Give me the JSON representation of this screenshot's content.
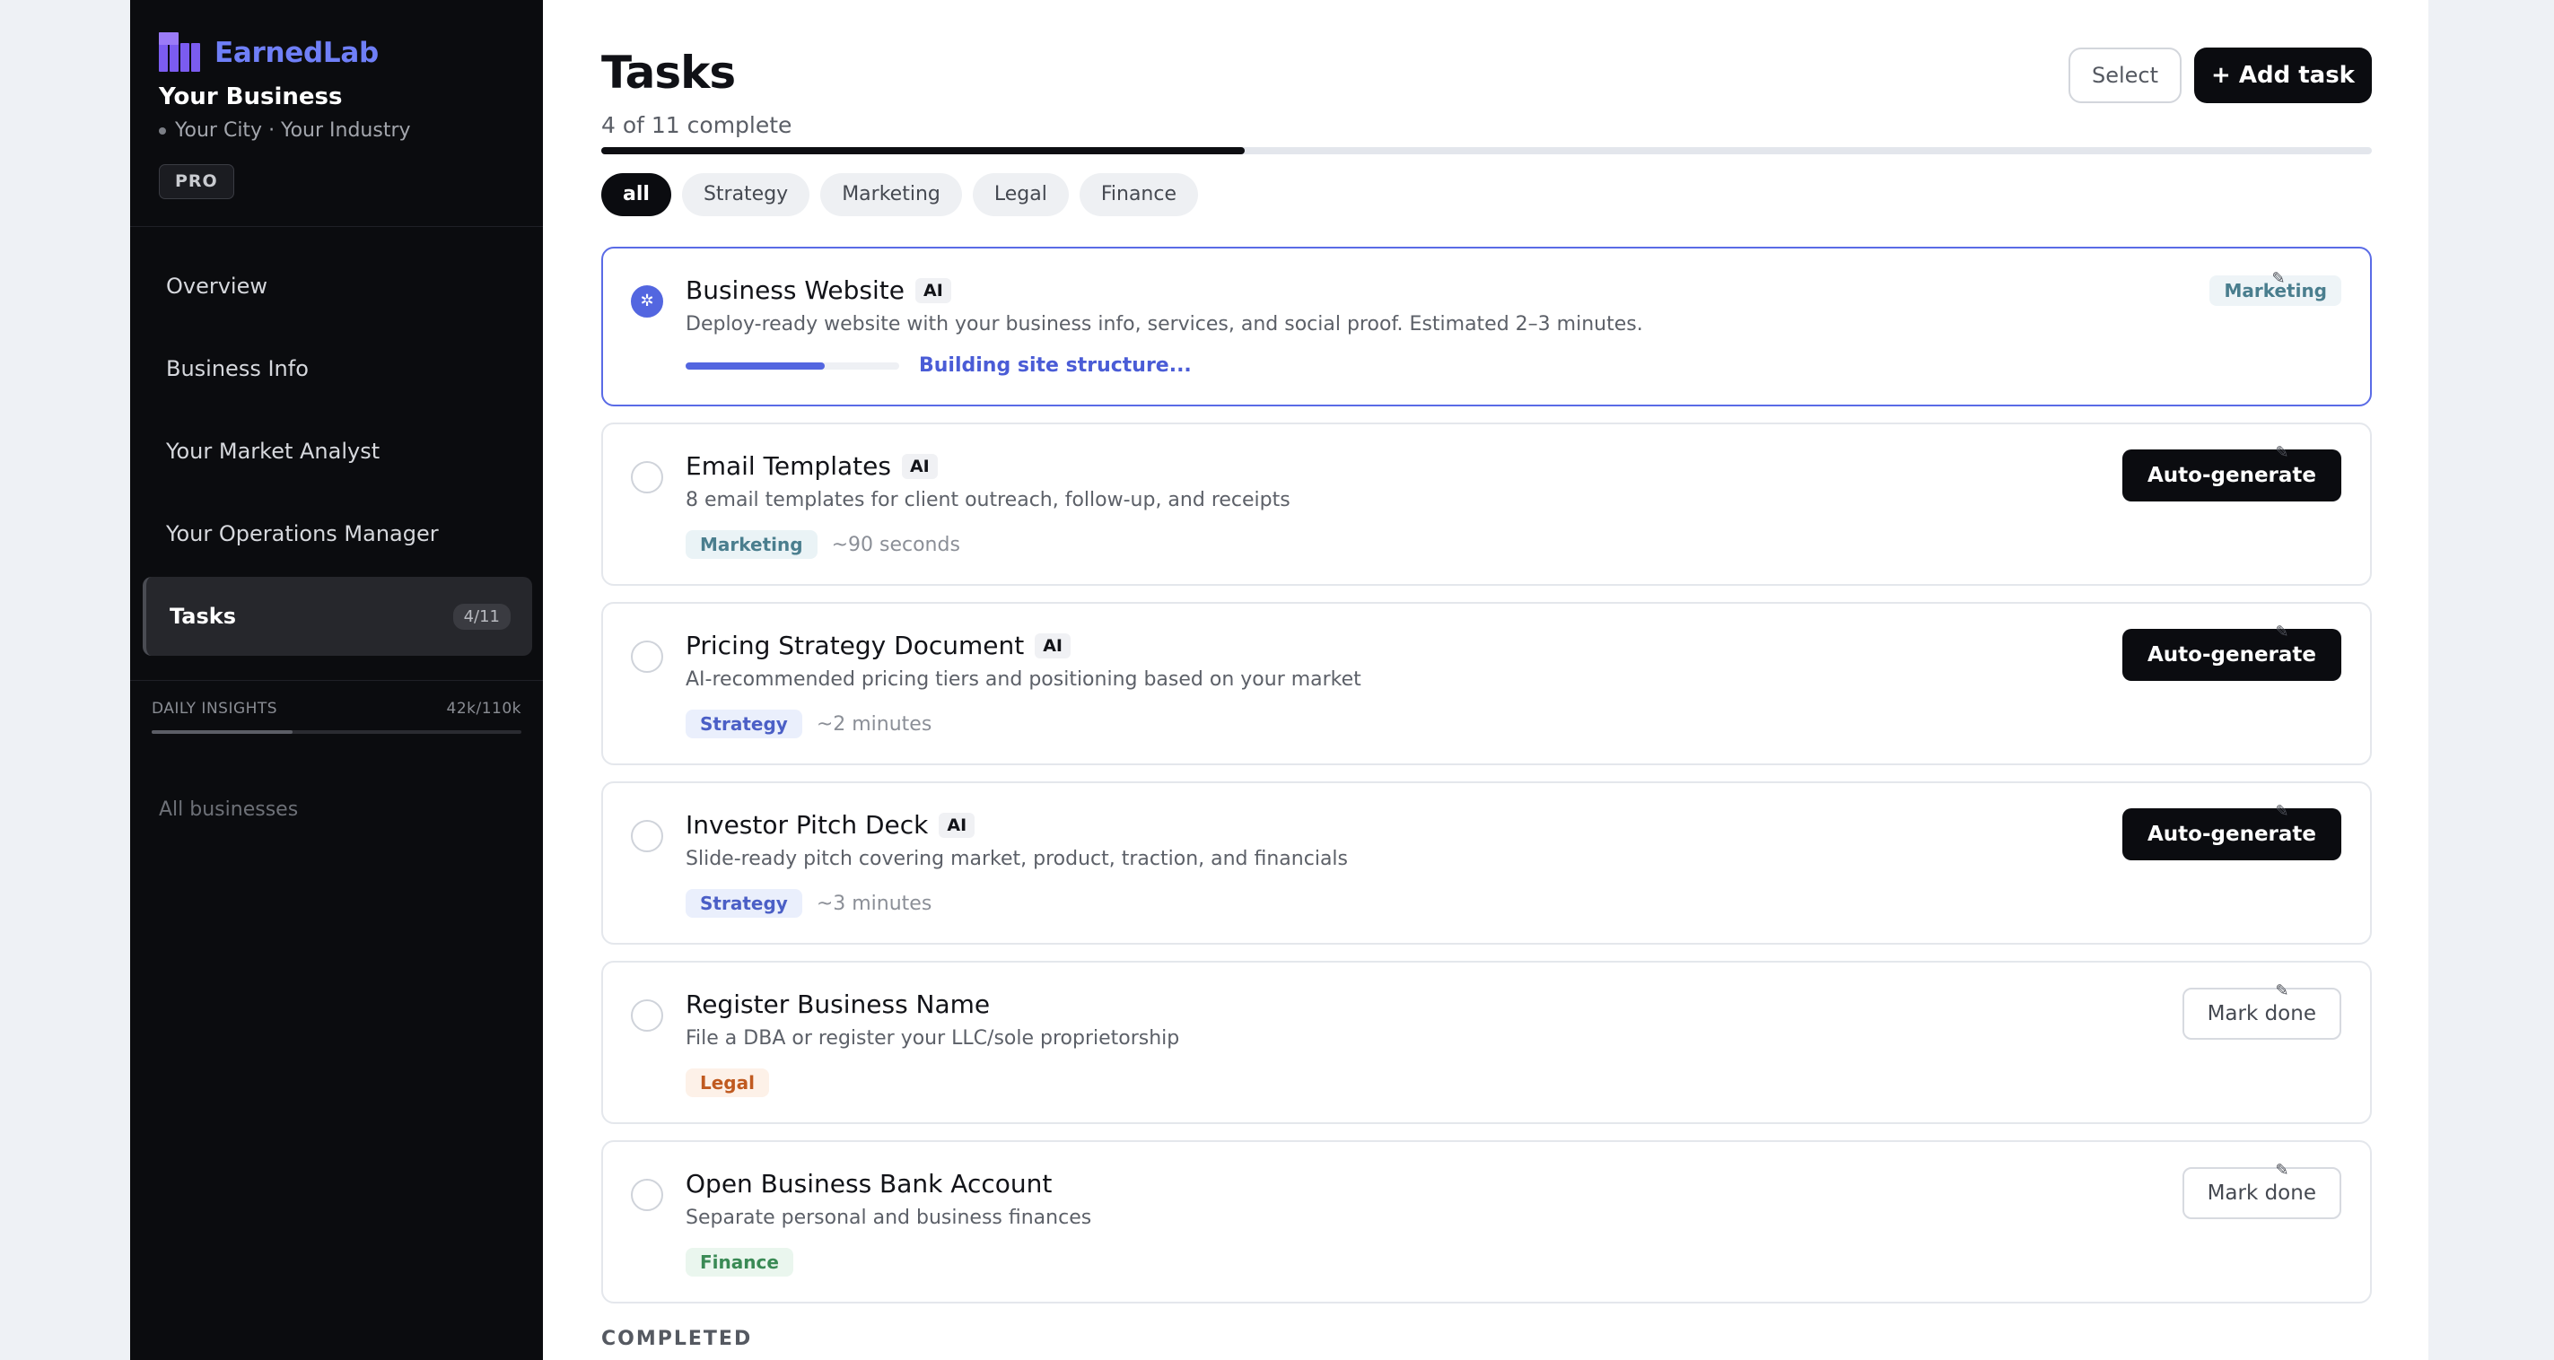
{
  "sidebar": {
    "brand": "EarnedLab",
    "business_name": "Your Business",
    "business_meta": "Your City · Your Industry",
    "plan_badge": "PRO",
    "nav": [
      {
        "label": "Overview"
      },
      {
        "label": "Business Info"
      },
      {
        "label": "Your Market Analyst"
      },
      {
        "label": "Your Operations Manager"
      },
      {
        "label": "Tasks",
        "count": "4/11",
        "active": true
      }
    ],
    "insights_label": "DAILY INSIGHTS",
    "insights_value": "42k/110k",
    "insights_fraction": 0.38,
    "all_businesses": "All businesses",
    "colors": {
      "brand_accent": "#6f7ff7",
      "logo": "#7b5cf0"
    }
  },
  "main": {
    "title": "Tasks",
    "progress_text": "4 of 11 complete",
    "progress_fraction": 0.3636,
    "select_label": "Select",
    "add_task_label": "+ Add task",
    "filters": [
      "all",
      "Strategy",
      "Marketing",
      "Legal",
      "Finance"
    ],
    "active_filter": "all",
    "tasks": [
      {
        "title": "Business Website",
        "ai": "AI",
        "description": "Deploy-ready website with your business info, services, and social proof. Estimated 2–3 minutes.",
        "status_text": "Building site structure...",
        "build_progress": 0.65,
        "category": "Marketing"
      },
      {
        "title": "Email Templates",
        "ai": "AI",
        "description": "8 email templates for client outreach, follow-up, and receipts",
        "category": "Marketing",
        "duration": "~90 seconds",
        "action": "Auto-generate"
      },
      {
        "title": "Pricing Strategy Document",
        "ai": "AI",
        "description": "AI-recommended pricing tiers and positioning based on your market",
        "category": "Strategy",
        "duration": "~2 minutes",
        "action": "Auto-generate"
      },
      {
        "title": "Investor Pitch Deck",
        "ai": "AI",
        "description": "Slide-ready pitch covering market, product, traction, and financials",
        "category": "Strategy",
        "duration": "~3 minutes",
        "action": "Auto-generate"
      },
      {
        "title": "Register Business Name",
        "description": "File a DBA or register your LLC/sole proprietorship",
        "category": "Legal",
        "action": "Mark done"
      },
      {
        "title": "Open Business Bank Account",
        "description": "Separate personal and business finances",
        "category": "Finance",
        "action": "Mark done"
      }
    ],
    "completed_heading": "COMPLETED",
    "icons": {
      "edit": "pencil-icon",
      "status": "spinner-icon",
      "check": "circle-check-icon"
    },
    "colors": {
      "accent": "#5366e0",
      "primary_button": "#0b0c10"
    }
  }
}
